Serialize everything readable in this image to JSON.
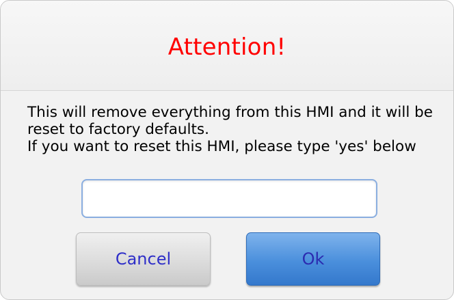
{
  "dialog": {
    "title": "Attention!",
    "message_lines": [
      "This will remove everything from this HMI and it will be",
      "reset to factory defaults.",
      "If you want to reset this HMI, please type 'yes' below"
    ],
    "input": {
      "value": "",
      "placeholder": ""
    },
    "cancel_label": "Cancel",
    "ok_label": "Ok"
  },
  "colors": {
    "title": "#ff0000",
    "button_text": "#2f2fc8",
    "ok_button": "#4a8fdc",
    "cancel_button": "#dcdcdc"
  }
}
